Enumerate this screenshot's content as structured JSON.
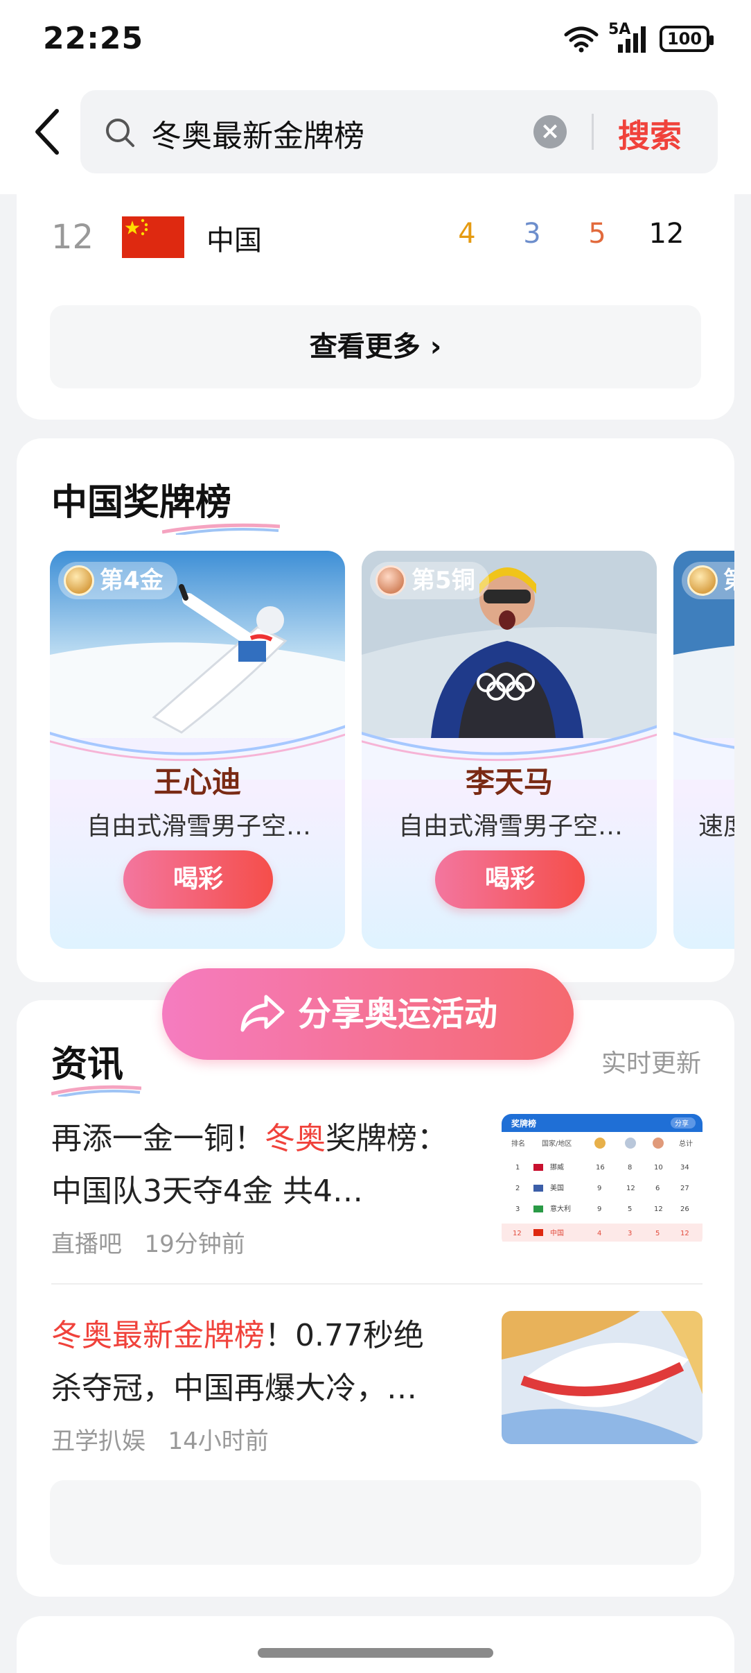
{
  "status_bar": {
    "time": "22:25",
    "network": "5A",
    "battery": "100"
  },
  "search": {
    "query": "冬奥最新金牌榜",
    "clear_label": "×",
    "button": "搜索"
  },
  "medal_table_row": {
    "rank": "12",
    "country": "中国",
    "gold": "4",
    "silver": "3",
    "bronze": "5",
    "total": "12"
  },
  "see_more": "查看更多 ›",
  "china_medals": {
    "title": "中国奖牌榜",
    "athletes": [
      {
        "badge": "第4金",
        "medal": "gold",
        "name": "王心迪",
        "event": "自由式滑雪男子空…",
        "cheer": "喝彩"
      },
      {
        "badge": "第5铜",
        "medal": "bronze",
        "name": "李天马",
        "event": "自由式滑雪男子空…",
        "cheer": "喝彩"
      },
      {
        "badge": "第",
        "medal": "gold",
        "name": "",
        "event": "速度",
        "cheer": ""
      }
    ]
  },
  "news_section": {
    "title": "资讯",
    "live_label": "实时更新",
    "items": [
      {
        "title_pre": "再添一金一铜！",
        "title_hl": "冬奥",
        "title_post": "奖牌榜：中国队3天夺4金 共4…",
        "source": "直播吧",
        "time": "19分钟前"
      },
      {
        "title_pre": "",
        "title_hl": "冬奥最新金牌榜",
        "title_post": "！0.77秒绝杀夺冠，中国再爆大冷，…",
        "source": "丑学扒娱",
        "time": "14小时前"
      }
    ],
    "thumb_table": {
      "header": "奖牌榜",
      "share": "分享",
      "columns": [
        "排名",
        "国家/地区",
        "金",
        "银",
        "铜",
        "总计"
      ],
      "rows": [
        [
          "1",
          "挪威",
          "16",
          "8",
          "10",
          "34"
        ],
        [
          "2",
          "美国",
          "9",
          "12",
          "6",
          "27"
        ],
        [
          "3",
          "意大利",
          "9",
          "5",
          "12",
          "26"
        ],
        [
          "12",
          "中国",
          "4",
          "3",
          "5",
          "12"
        ]
      ]
    }
  },
  "share_button": "分享奥运活动",
  "colors": {
    "accent": "#f0423b",
    "gold": "#e59b12",
    "silver": "#6d8ecc",
    "bronze": "#e26a3c"
  }
}
